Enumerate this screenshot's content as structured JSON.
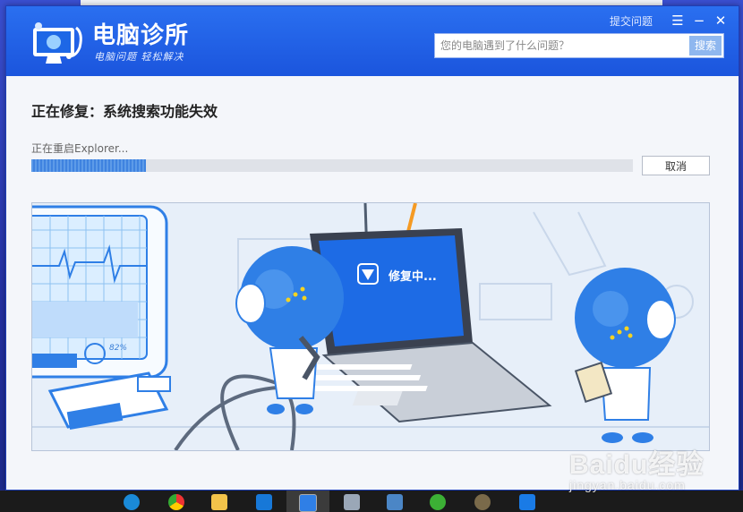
{
  "app": {
    "title": "电脑诊所",
    "slogan": "电脑问题 轻松解决"
  },
  "titlebar": {
    "feedback_label": "提交问题",
    "menu_icon": "menu-icon",
    "minimize_icon": "minimize-icon",
    "close_icon": "close-icon"
  },
  "search": {
    "placeholder": "您的电脑遇到了什么问题？",
    "button_label": "搜索"
  },
  "repair": {
    "title": "正在修复：系统搜索功能失效",
    "status_text": "正在重启Explorer...",
    "progress": 0.19,
    "cancel_label": "取消"
  },
  "illustration": {
    "laptop_text": "修复中...",
    "monitor_percent": "82%"
  },
  "taskbar": {
    "apps": [
      "edge-icon",
      "chrome-icon",
      "folder-icon",
      "settings-icon",
      "diagnosis-app-icon",
      "image-viewer-icon",
      "computer-icon",
      "wechat-icon",
      "avatar-icon",
      "security-icon"
    ]
  },
  "watermark": {
    "main": "Baidu经验",
    "sub": "jingyan.baidu.com"
  },
  "colors": {
    "titlebar": "#1b55dd",
    "accent": "#3f83e0",
    "robot": "#2f7fe6"
  }
}
